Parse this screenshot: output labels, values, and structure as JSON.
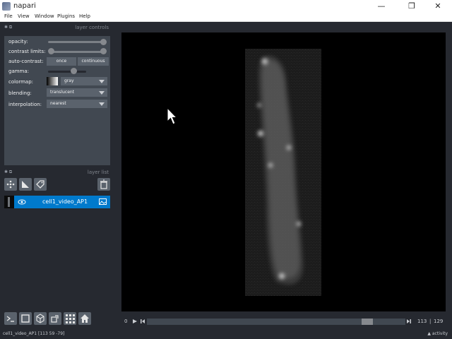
{
  "window": {
    "title": "napari",
    "minimize": "—",
    "maximize": "❐",
    "close": "✕"
  },
  "menu": [
    "File",
    "View",
    "Window",
    "Plugins",
    "Help"
  ],
  "layer_controls": {
    "title": "layer controls",
    "opacity_label": "opacity:",
    "opacity_value": 1.0,
    "contrast_label": "contrast limits:",
    "contrast_range": [
      0.0,
      1.0
    ],
    "autocontrast_label": "auto-contrast:",
    "once_label": "once",
    "continuous_label": "continuous",
    "gamma_label": "gamma:",
    "gamma_value": 0.5,
    "colormap_label": "colormap:",
    "colormap_value": "gray",
    "blending_label": "blending:",
    "blending_value": "translucent",
    "interpolation_label": "interpolation:",
    "interpolation_value": "nearest"
  },
  "layer_list": {
    "title": "layer list",
    "layers": [
      {
        "name": "cell1_video_AP1",
        "visible": true
      }
    ]
  },
  "dims": {
    "start": "0",
    "current": "113",
    "max": "129",
    "position": 0.87
  },
  "status": {
    "text": "cell1_video_AP1 [113 59 -79]",
    "activity": "activity"
  },
  "colors": {
    "accent": "#007acc",
    "panel": "#414851",
    "background": "#262930"
  }
}
